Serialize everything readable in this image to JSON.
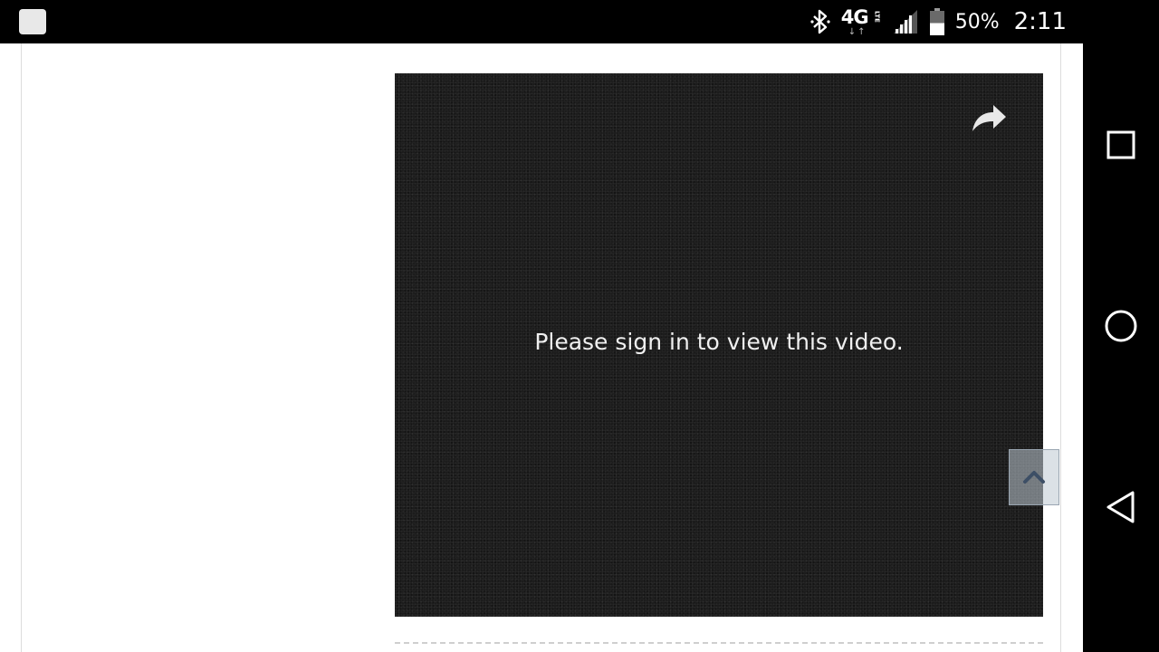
{
  "status_bar": {
    "network_label": "4G",
    "network_sub": "LTE",
    "battery_percent": "50%",
    "battery_level": 0.5,
    "time": "2:11",
    "icons": [
      "notification-icon",
      "bluetooth-icon",
      "4g-lte-icon",
      "signal-icon",
      "battery-icon"
    ]
  },
  "video": {
    "message": "Please sign in to view this video.",
    "share_icon": "share-arrow-icon"
  },
  "navigation": {
    "icons": [
      "recents-square-icon",
      "home-circle-icon",
      "back-triangle-icon"
    ]
  },
  "page": {
    "back_to_top_icon": "chevron-up-icon"
  },
  "colors": {
    "status_bar_bg": "#000000",
    "page_bg": "#ffffff",
    "video_bg": "#1c1c1c",
    "video_text": "#f0f0f0"
  }
}
